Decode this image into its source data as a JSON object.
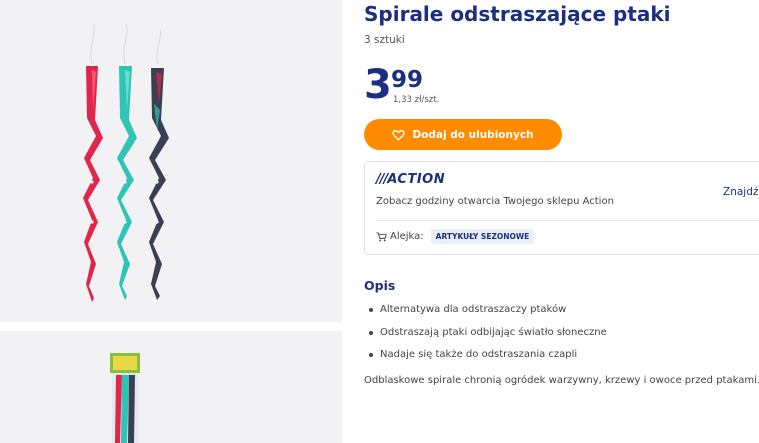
{
  "product": {
    "title": "Spirale odstraszające ptaki",
    "quantity": "3 sztuki",
    "price_int": "3",
    "price_dec": "99",
    "unit_price": "1,33 zł/szt.",
    "favorite_label": "Dodaj do ulubionych",
    "favorite_icon": "heart-icon"
  },
  "store": {
    "logo_text": "ACTION",
    "find_label": "Znajdź",
    "hours_text": "Zobacz godziny otwarcia Twojego sklepu Action",
    "aisle_label": "Alejka:",
    "aisle_icon": "cart-icon",
    "aisle_badge": "ARTYKUŁY SEZONOWE"
  },
  "description": {
    "heading": "Opis",
    "bullets": [
      "Alternatywa dla odstraszaczy ptaków",
      "Odstraszają ptaki odbijając światło słoneczne",
      "Nadaje się także do odstraszania czapli"
    ],
    "text": "Odblaskowe spirale chronią ogródek warzywny, krzewy i owoce przed ptakami."
  },
  "colors": {
    "brand_blue": "#1b2f80",
    "orange": "#ff8c00",
    "spiral_red": "#e0264a",
    "spiral_teal": "#2ec4b6",
    "spiral_dark": "#3a3f52"
  }
}
